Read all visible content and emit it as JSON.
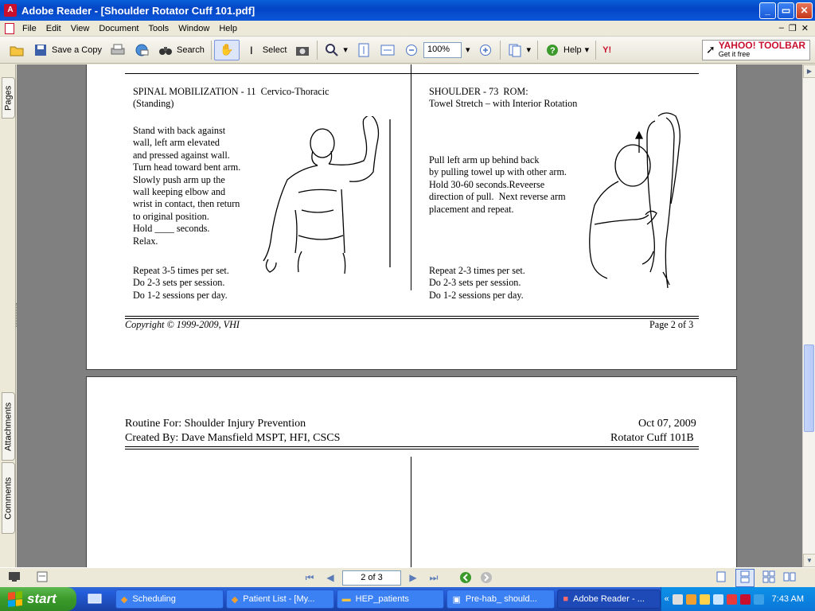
{
  "window": {
    "title": "Adobe Reader - [Shoulder Rotator Cuff 101.pdf]",
    "buttons": {
      "minimize": "_",
      "maximize": "▭",
      "close": "✕"
    }
  },
  "menu": {
    "items": [
      "File",
      "Edit",
      "View",
      "Document",
      "Tools",
      "Window",
      "Help"
    ]
  },
  "toolbar": {
    "save_copy": "Save a Copy",
    "search": "Search",
    "select": "Select",
    "zoom_value": "100%",
    "help": "Help",
    "yahoo_logo": "YAHOO! TOOLBAR",
    "yahoo_sub": "Get it free"
  },
  "side_tabs": {
    "pages": "Pages",
    "attachments": "Attachments",
    "comments": "Comments"
  },
  "page2": {
    "left_title": "SPINAL MOBILIZATION - 11  Cervico-Thoracic\n(Standing)",
    "left_instructions": "Stand with back against\nwall, left arm elevated\nand pressed against wall.\nTurn head toward bent arm.\nSlowly push arm up the\nwall keeping elbow and\nwrist in contact, then return\nto original position.\nHold ____ seconds.\nRelax.",
    "left_reps": "Repeat 3-5 times per set.\nDo 2-3 sets per session.\nDo 1-2 sessions per day.",
    "right_title": "SHOULDER - 73  ROM:\nTowel Stretch – with Interior Rotation",
    "right_instructions": "Pull left arm up behind back\nby pulling towel up with other arm.\nHold 30-60 seconds.Reveerse\ndirection of pull.  Next reverse arm\nplacement and repeat.",
    "right_reps": "Repeat 2-3 times per set.\nDo 2-3 sets per session.\nDo 1-2 sessions per day.",
    "copyright": "Copyright © 1999-2009, VHI",
    "page_label": "Page 2 of 3"
  },
  "page3": {
    "routine": "Routine For: Shoulder Injury Prevention",
    "created_by": "Created By: Dave Mansfield MSPT, HFI, CSCS",
    "date": "Oct 07, 2009",
    "doc_name": "Rotator Cuff 101B"
  },
  "status": {
    "page_indicator": "2 of 3"
  },
  "taskbar": {
    "start": "start",
    "tasks": [
      "Scheduling",
      "Patient List - [My...",
      "HEP_patients",
      "Pre-hab_ should...",
      "Adobe Reader - ..."
    ],
    "clock": "7:43 AM"
  }
}
